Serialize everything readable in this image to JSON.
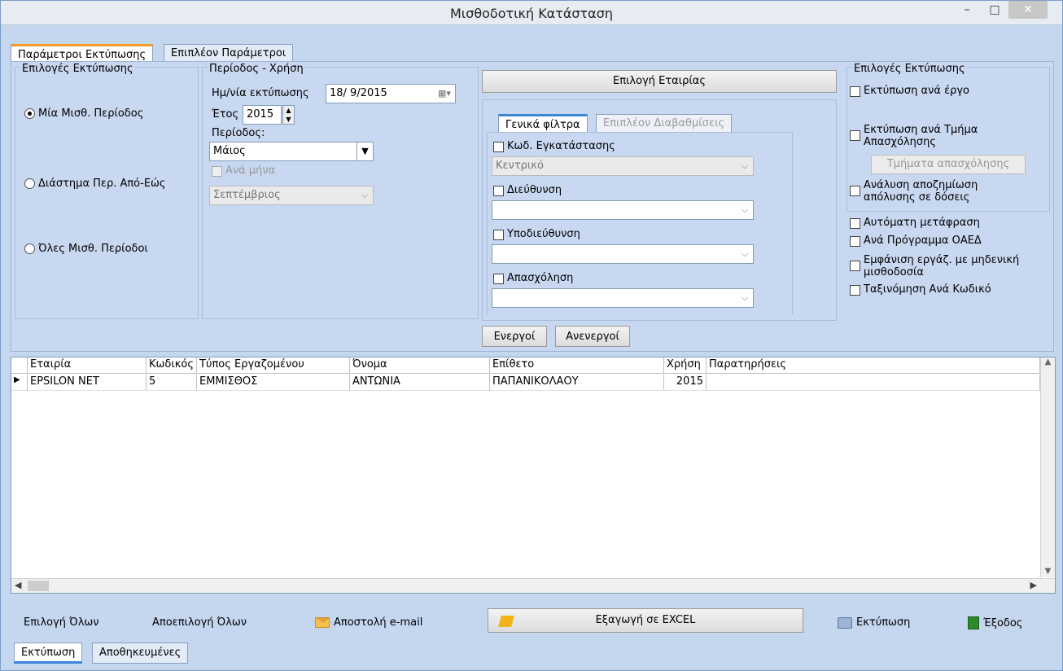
{
  "window": {
    "title": "Μισθοδοτική Κατάσταση",
    "min": "–",
    "max": "□",
    "close": "✕"
  },
  "top_tabs": [
    "Παράμετροι Εκτύπωσης",
    "Επιπλέον Παράμετροι"
  ],
  "print_options_group": {
    "title": "Επιλογές Εκτύπωσης",
    "options": [
      {
        "label": "Μία Μισθ. Περίοδος",
        "selected": true
      },
      {
        "label": "Διάστημα Περ. Από-Εώς",
        "selected": false
      },
      {
        "label": "Όλες Μισθ. Περίοδοι",
        "selected": false
      }
    ]
  },
  "period_group": {
    "title": "Περίοδος - Χρήση",
    "print_date_label": "Ημ/νία εκτύπωσης",
    "print_date_value": "18/ 9/2015",
    "year_label": "Έτος",
    "year_value": "2015",
    "period_label": "Περίοδος:",
    "period_value": "Μάιος",
    "per_month_label": "Ανά μήνα",
    "to_month_value": "Σεπτέμβριος"
  },
  "company_button": "Επιλογή Εταιρίας",
  "filter_tabs": [
    "Γενικά φίλτρα",
    "Επιπλέον Διαβαθμίσεις"
  ],
  "filters": [
    {
      "label": "Κωδ. Εγκατάστασης",
      "value": "Κεντρικό"
    },
    {
      "label": "Διεύθυνση",
      "value": ""
    },
    {
      "label": "Υποδιεύθυνση",
      "value": ""
    },
    {
      "label": "Απασχόληση",
      "value": ""
    }
  ],
  "active_button": "Ενεργοί",
  "inactive_button": "Ανενεργοί",
  "right_options": {
    "title": "Επιλογές Εκτύπωσης",
    "per_project": "Εκτύπωση ανά έργο",
    "per_dept": "Εκτύπωση ανά Τμήμα Απασχόλησης",
    "depts_button": "Τμήματα απασχόλησης",
    "severance": "Ανάλυση αποζημίωση απόλυσης σε δόσεις",
    "auto_translate": "Αυτόματη μετάφραση",
    "oaed": "Ανά Πρόγραμμα ΟΑΕΔ",
    "zero_pay": "Εμφάνιση εργάζ. με μηδενική μισθοδοσία",
    "sort_code": "Ταξινόμηση Ανά Κωδικό"
  },
  "grid": {
    "columns": [
      "Εταιρία",
      "Κωδικός",
      "Τύπος Εργαζομένου",
      "Όνομα",
      "Επίθετο",
      "Χρήση",
      "Παρατηρήσεις"
    ],
    "rows": [
      [
        "EPSILON NET",
        "5",
        "ΕΜΜΙΣΘΟΣ",
        "ΑΝΤΩΝΙΑ",
        "ΠΑΠΑΝΙΚΟΛΑΟΥ",
        "2015",
        ""
      ]
    ]
  },
  "bottom": {
    "select_all": "Επιλογή Όλων",
    "deselect_all": "Αποεπιλογή Όλων",
    "send_email": "Αποστολή e-mail",
    "export_excel": "Εξαγωγή σε EXCEL",
    "print": "Εκτύπωση",
    "exit": "Έξοδος"
  },
  "bottom_tabs": [
    "Εκτύπωση",
    "Αποθηκευμένες"
  ]
}
